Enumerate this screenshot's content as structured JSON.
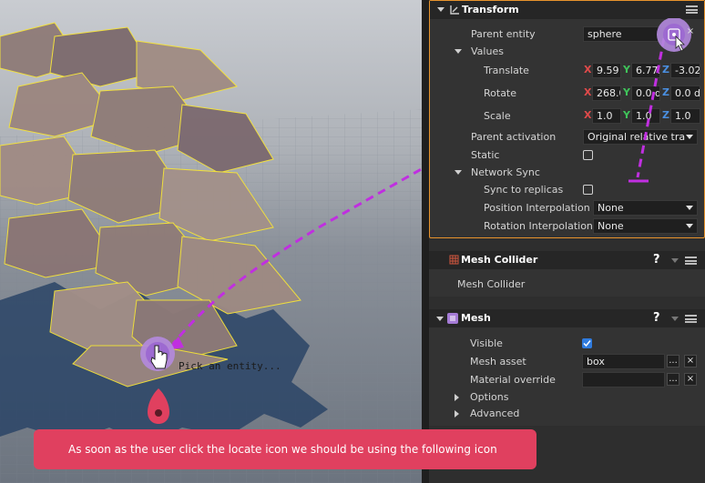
{
  "colors": {
    "accent_orange": "#e8932c",
    "annotation_purple": "#c02fe0",
    "toast_pink": "#e0405f",
    "checkbox_blue": "#2f7bde"
  },
  "viewport": {
    "pick_label": "Pick an entity..."
  },
  "transform": {
    "title": "Transform",
    "parent_entity_label": "Parent entity",
    "parent_entity_value": "sphere",
    "values_label": "Values",
    "translate_label": "Translate",
    "translate": {
      "x": "9.59",
      "y": "6.772",
      "z": "-3.02"
    },
    "rotate_label": "Rotate",
    "rotate": {
      "x": "268.0",
      "y": "0.0 d",
      "z": "0.0 d"
    },
    "scale_label": "Scale",
    "scale": {
      "x": "1.0",
      "y": "1.0",
      "z": "1.0"
    },
    "axis_x": "X",
    "axis_y": "Y",
    "axis_z": "Z",
    "parent_activation_label": "Parent activation",
    "parent_activation_value": "Original relative tra",
    "static_label": "Static",
    "static_checked": false,
    "network_sync_label": "Network Sync",
    "sync_replicas_label": "Sync to replicas",
    "sync_replicas_checked": false,
    "position_interp_label": "Position Interpolation",
    "position_interp_value": "None",
    "rotation_interp_label": "Rotation Interpolation",
    "rotation_interp_value": "None",
    "clear_symbol": "×"
  },
  "mesh_collider": {
    "title": "Mesh Collider",
    "body_label": "Mesh Collider",
    "help": "?"
  },
  "mesh": {
    "title": "Mesh",
    "help": "?",
    "visible_label": "Visible",
    "visible_checked": true,
    "mesh_asset_label": "Mesh asset",
    "mesh_asset_value": "box",
    "material_override_label": "Material override",
    "material_override_value": "",
    "browse_symbol": "...",
    "clear_symbol": "×",
    "options_label": "Options",
    "advanced_label": "Advanced"
  },
  "toast": {
    "message": "As soon as the user click the locate icon  we should be using the following icon"
  }
}
